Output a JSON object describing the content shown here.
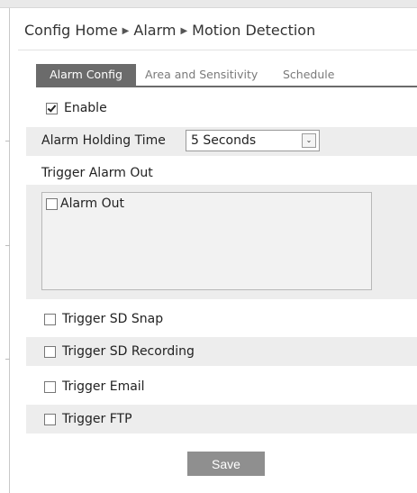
{
  "breadcrumb": [
    "Config Home",
    "Alarm",
    "Motion Detection"
  ],
  "breadcrumb_separator": "▶",
  "tabs": {
    "alarm_config": "Alarm Config",
    "area_sensitivity": "Area and Sensitivity",
    "schedule": "Schedule",
    "active": "Alarm Config"
  },
  "enable": {
    "label": "Enable",
    "checked": true
  },
  "alarm_holding_time": {
    "label": "Alarm Holding Time",
    "value": "5 Seconds"
  },
  "trigger_alarm_out": {
    "label": "Trigger Alarm Out",
    "items": [
      {
        "label": "Alarm Out",
        "checked": false
      }
    ]
  },
  "options": {
    "sd_snap": {
      "label": "Trigger SD Snap",
      "checked": false
    },
    "sd_recording": {
      "label": "Trigger SD Recording",
      "checked": false
    },
    "email": {
      "label": "Trigger Email",
      "checked": false
    },
    "ftp": {
      "label": "Trigger FTP",
      "checked": false
    }
  },
  "save_label": "Save",
  "colors": {
    "active_tab": "#6b6b6b",
    "row_stripe": "#ededed",
    "save_button": "#8f8f8f"
  }
}
